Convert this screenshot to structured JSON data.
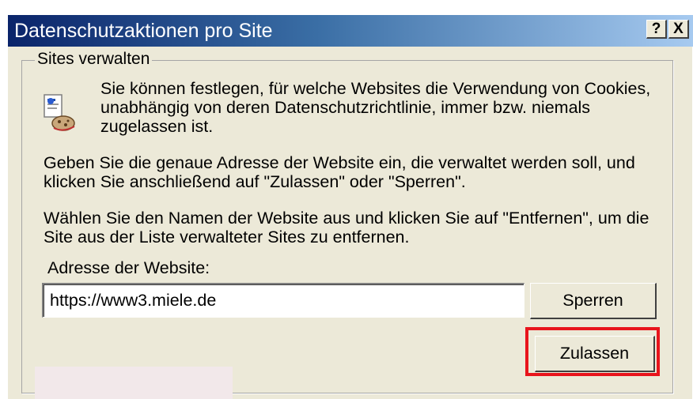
{
  "dialog": {
    "title": "Datenschutzaktionen pro Site",
    "help_button": "?",
    "close_button": "X"
  },
  "group": {
    "legend": "Sites verwalten",
    "intro_lines": [
      "Sie können festlegen, für welche Websites die Verwendung von Cookies,",
      "unabhängig von deren Datenschutzrichtlinie, immer bzw. niemals",
      "zugelassen ist."
    ],
    "enter_lines": [
      "Geben Sie die genaue Adresse der Website ein, die verwaltet werden soll, und",
      "klicken Sie anschließend auf \"Zulassen\" oder \"Sperren\"."
    ],
    "remove_lines": [
      "Wählen Sie den Namen der Website aus und klicken Sie auf \"Entfernen\", um die",
      "Site aus der Liste verwalteter Sites zu entfernen."
    ],
    "address_label": "Adresse der Website:",
    "address_value": "https://www3.miele.de",
    "block_button": "Sperren",
    "allow_button": "Zulassen"
  },
  "colors": {
    "title_gradient_start": "#0a246a",
    "title_gradient_end": "#a6caf0",
    "dialog_bg": "#ece9d8",
    "highlight": "#e8141c"
  },
  "icons": {
    "privacy": "privacy-cookie-icon"
  }
}
